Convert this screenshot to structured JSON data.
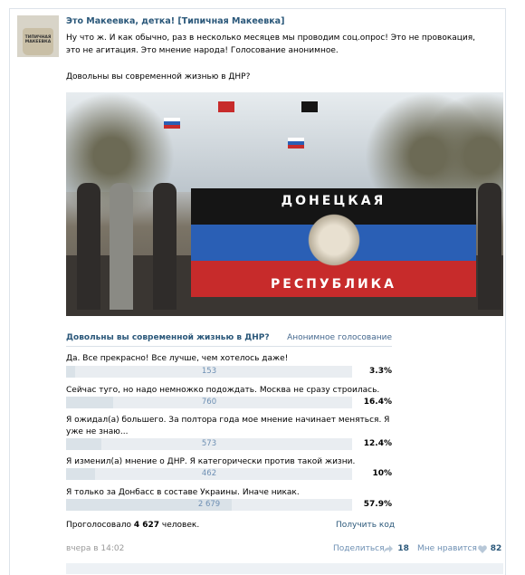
{
  "post": {
    "author": "Это Макеевка, детка! [Типичная Макеевка]",
    "avatar_text": "ТИПИЧНАЯ МАКЕЕВКА",
    "text": "Ну что ж. И как обычно, раз в несколько месяцев мы проводим соц.опрос! Это не провокация, это не агитация. Это мнение народа! Голосование анонимное.",
    "question": "Довольны вы современной жизнью в ДНР?",
    "photo_flag_top": "ДОНЕЦКАЯ",
    "photo_flag_bottom": "РЕСПУБЛИКА"
  },
  "poll": {
    "question": "Довольны вы современной жизнью в ДНР?",
    "type": "Анонимное голосование",
    "options": [
      {
        "label": "Да. Все прекрасно! Все лучше, чем хотелось даже!",
        "count": "153",
        "pct": "3.3%",
        "fraction": 0.033
      },
      {
        "label": "Сейчас туго, но надо немножко подождать. Москва не сразу строилась.",
        "count": "760",
        "pct": "16.4%",
        "fraction": 0.164
      },
      {
        "label": "Я ожидал(а) большего. За полтора года мое мнение начинает меняться. Я уже не знаю...",
        "count": "573",
        "pct": "12.4%",
        "fraction": 0.124
      },
      {
        "label": "Я изменил(а) мнение о ДНР. Я категорически против такой жизни.",
        "count": "462",
        "pct": "10%",
        "fraction": 0.1
      },
      {
        "label": "Я только за Донбасс в составе Украины. Иначе никак.",
        "count": "2 679",
        "pct": "57.9%",
        "fraction": 0.579
      }
    ],
    "voted_prefix": "Проголосовало ",
    "voted_count": "4 627",
    "voted_suffix": " человек.",
    "code_link": "Получить код"
  },
  "footer": {
    "time": "вчера в 14:02",
    "share_label": "Поделиться",
    "share_count": "18",
    "like_label": "Мне нравится",
    "like_count": "82"
  }
}
